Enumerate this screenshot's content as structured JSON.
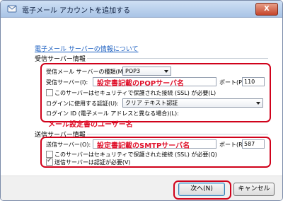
{
  "window": {
    "title": "電子メール アカウントを追加する",
    "close_label": "X"
  },
  "intro_link": "電子メール サーバーの情報について",
  "incoming": {
    "section_title": "受信サーバー情報",
    "type_label": "受信メール サーバーの種類(M):",
    "type_value": "POP3",
    "server_label": "受信サーバー(I):",
    "server_value": "",
    "server_annotation": "設定書記載のPOPサーバ名",
    "port_label": "ポート(P):",
    "port_value": "110",
    "ssl_label": "このサーバーはセキュリティで保護された接続 (SSL) が必要(L)",
    "ssl_checked": false,
    "logon_label": "ログインに使用する認証(U):",
    "logon_value": "クリア テキスト認証",
    "logon_id_label": "ログイン ID (電子メール アドレスと異なる場合)(L):",
    "logon_id_value": "",
    "logon_id_annotation": "メール設定書のユーザー名"
  },
  "outgoing": {
    "section_title": "送信サーバー情報",
    "server_label": "送信サーバー(O):",
    "server_value": "",
    "server_annotation": "設定書記載のSMTPサーバ名",
    "port_label": "ポート(R):",
    "port_value": "587",
    "ssl_label": "このサーバーはセキュリティで保護された接続 (SSL) が必要(Q)",
    "ssl_checked": false,
    "auth_label": "送信サーバーは認証が必要(V)",
    "auth_checked": true
  },
  "footer": {
    "next_label": "次へ(N)",
    "cancel_label": "キャンセル"
  }
}
